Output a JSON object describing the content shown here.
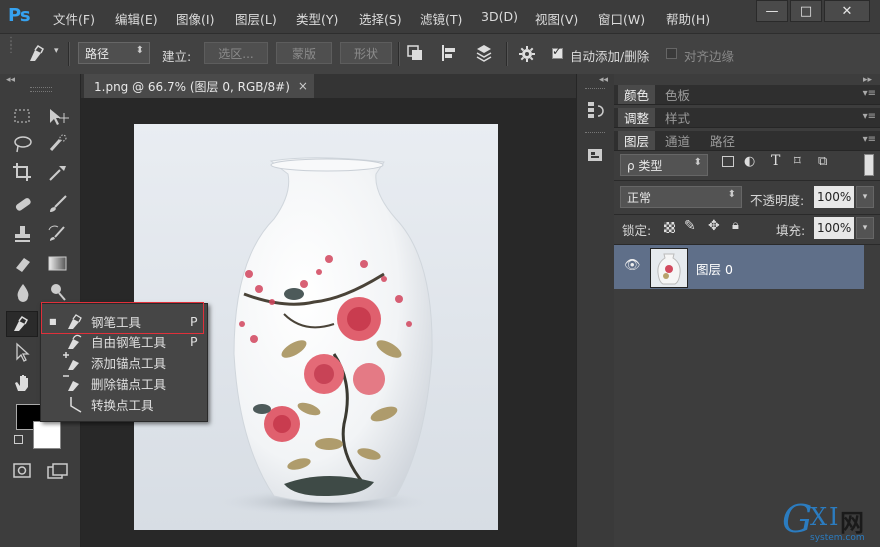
{
  "app": {
    "logo": "Ps"
  },
  "menu": [
    "文件(F)",
    "编辑(E)",
    "图像(I)",
    "图层(L)",
    "类型(Y)",
    "选择(S)",
    "滤镜(T)",
    "3D(D)",
    "视图(V)",
    "窗口(W)",
    "帮助(H)"
  ],
  "window_controls": {
    "minimize": "—",
    "maximize": "□",
    "close": "✕"
  },
  "options": {
    "mode_value": "路径",
    "make_label": "建立:",
    "selection_btn": "选区...",
    "mask_btn": "蒙版",
    "shape_btn": "形状",
    "auto_add_delete": "自动添加/删除",
    "align_edges": "对齐边缘"
  },
  "document": {
    "tab_title": "1.png @ 66.7% (图层 0, RGB/8#)",
    "tab_close": "×"
  },
  "flyout": {
    "items": [
      {
        "label": "钢笔工具",
        "key": "P",
        "selected": true
      },
      {
        "label": "自由钢笔工具",
        "key": "P",
        "selected": false
      },
      {
        "label": "添加锚点工具",
        "key": "",
        "selected": false
      },
      {
        "label": "删除锚点工具",
        "key": "",
        "selected": false
      },
      {
        "label": "转换点工具",
        "key": "",
        "selected": false
      }
    ]
  },
  "panels": {
    "group1": [
      "颜色",
      "色板"
    ],
    "group2": [
      "调整",
      "样式"
    ],
    "group3": [
      "图层",
      "通道",
      "路径"
    ],
    "filter_kind": "ρ 类型",
    "blend_mode": "正常",
    "opacity_label": "不透明度:",
    "opacity_value": "100%",
    "lock_label": "锁定:",
    "fill_label": "填充:",
    "fill_value": "100%",
    "layer_name": "图层 0"
  },
  "watermark": {
    "text1": "G",
    "text2": "X",
    "text3": "I",
    "text4": "网",
    "sub": "system.com"
  },
  "colors": {
    "accent": "#36a2f0",
    "highlight": "#e0303a",
    "layer_selected": "#5f6f89"
  }
}
